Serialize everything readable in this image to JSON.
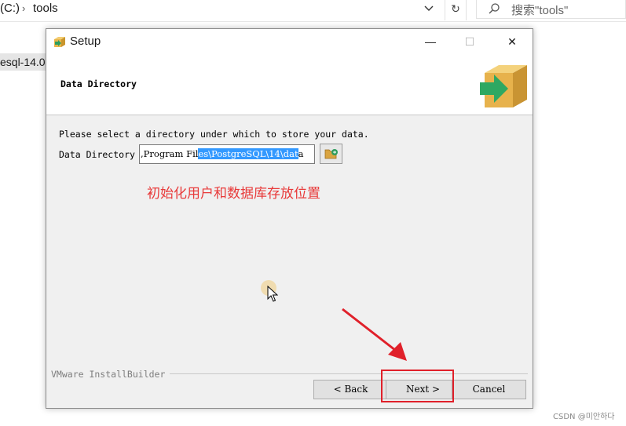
{
  "explorer": {
    "drive": "(C:)",
    "separator": "›",
    "folder": "tools",
    "refresh_glyph": "↻",
    "search_placeholder": "搜索\"tools\"",
    "side_item": "esql-14.0-"
  },
  "dialog": {
    "title": "Setup",
    "min_glyph": "—",
    "max_glyph": "☐",
    "close_glyph": "✕",
    "header_title": "Data Directory",
    "prompt": "Please select a directory under which to store your data.",
    "field_label": "Data Directory",
    "field_value_plain": ",Program Fil",
    "field_value_selected": "es\\PostgreSQL\\14\\dat",
    "field_value_tail": "a",
    "vendor": "VMware InstallBuilder",
    "buttons": {
      "back": "< Back",
      "next": "Next >",
      "cancel": "Cancel"
    }
  },
  "annotation": "初始化用户和数据库存放位置",
  "watermark": "CSDN @미안하다",
  "icons": {
    "app": "installer-box-icon",
    "header": "installer-box-arrow-icon",
    "browse": "folder-browse-icon"
  },
  "colors": {
    "selection": "#3399ff",
    "annotation": "#e83a3a",
    "highlight_box": "#e0202a"
  }
}
